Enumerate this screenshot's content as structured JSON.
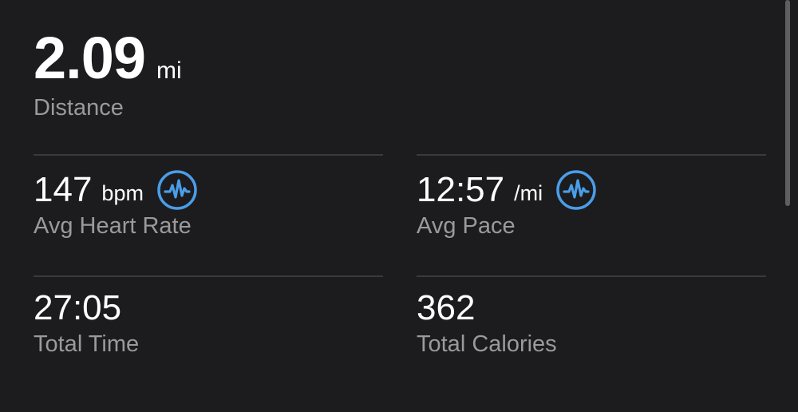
{
  "distance": {
    "value": "2.09",
    "unit": "mi",
    "label": "Distance"
  },
  "stats": [
    {
      "value": "147",
      "unit": "bpm",
      "label": "Avg Heart Rate",
      "icon": "heart-rate-chart-icon"
    },
    {
      "value": "12:57",
      "unit": "/mi",
      "label": "Avg Pace",
      "icon": "pace-chart-icon"
    },
    {
      "value": "27:05",
      "unit": "",
      "label": "Total Time"
    },
    {
      "value": "362",
      "unit": "",
      "label": "Total Calories"
    }
  ],
  "colors": {
    "background": "#1c1c1e",
    "label": "#9a9a9e",
    "divider": "#3a3a3c",
    "accent": "#4a9de8"
  }
}
